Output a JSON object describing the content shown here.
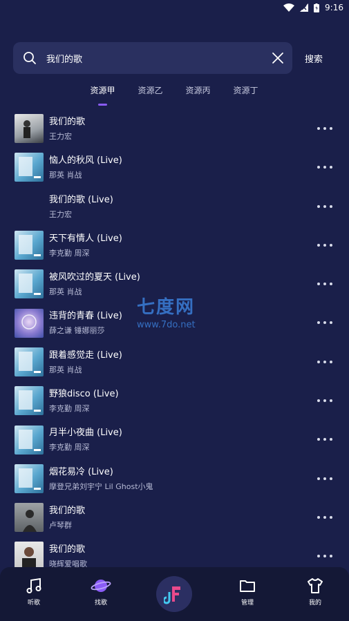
{
  "status": {
    "time": "9:16"
  },
  "search": {
    "value": "我们的歌",
    "button_label": "搜索"
  },
  "tabs": [
    {
      "label": "资源甲",
      "active": true
    },
    {
      "label": "资源乙",
      "active": false
    },
    {
      "label": "资源丙",
      "active": false
    },
    {
      "label": "资源丁",
      "active": false
    }
  ],
  "songs": [
    {
      "title": "我们的歌",
      "artist": "王力宏"
    },
    {
      "title": "恼人的秋风 (Live)",
      "artist": "那英  肖战"
    },
    {
      "title": "我们的歌 (Live)",
      "artist": "王力宏"
    },
    {
      "title": "天下有情人 (Live)",
      "artist": "李克勤  周深"
    },
    {
      "title": "被风吹过的夏天 (Live)",
      "artist": "那英  肖战"
    },
    {
      "title": "违背的青春 (Live)",
      "artist": "薛之谦  锤娜丽莎"
    },
    {
      "title": "跟着感觉走 (Live)",
      "artist": "那英  肖战"
    },
    {
      "title": "野狼disco (Live)",
      "artist": "李克勤  周深"
    },
    {
      "title": "月半小夜曲 (Live)",
      "artist": "李克勤  周深"
    },
    {
      "title": "烟花易冷 (Live)",
      "artist": "摩登兄弟刘宇宁  Lil Ghost小鬼"
    },
    {
      "title": "我们的歌",
      "artist": "卢琴群"
    },
    {
      "title": "我们的歌",
      "artist": "晓辉爱唱歌"
    }
  ],
  "watermark": {
    "big": "七度网",
    "small": "www.7do.net"
  },
  "nav": [
    {
      "label": "听歌",
      "icon": "music-note-icon"
    },
    {
      "label": "找歌",
      "icon": "planet-icon"
    },
    {
      "label": "",
      "icon": "app-logo-icon"
    },
    {
      "label": "管理",
      "icon": "folder-icon"
    },
    {
      "label": "我的",
      "icon": "tshirt-icon"
    }
  ],
  "colors": {
    "background": "#1a1f4a",
    "accent": "#8a5cf6",
    "search_bg": "#2a3060"
  }
}
